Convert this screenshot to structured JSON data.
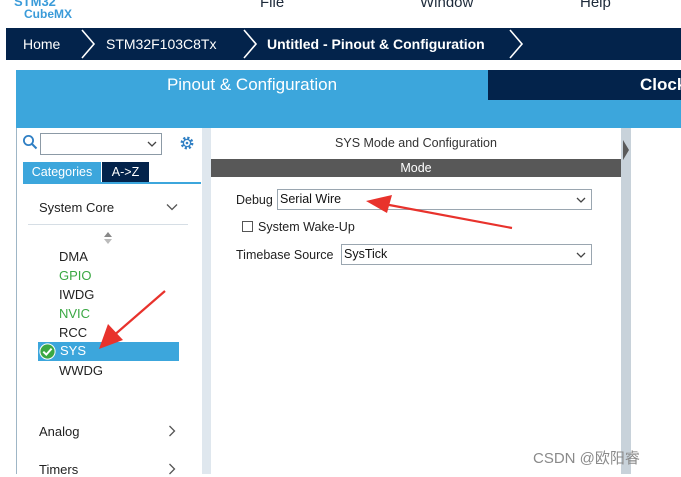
{
  "app": {
    "logo_line1": "STM32",
    "logo_line2": "CubeMX"
  },
  "menu": {
    "items": [
      "File",
      "Window",
      "Help"
    ]
  },
  "breadcrumb": {
    "items": [
      "Home",
      "STM32F103C8Tx",
      "Untitled - Pinout & Configuration"
    ]
  },
  "tabs": {
    "pinout": "Pinout & Configuration",
    "clock": "Clock"
  },
  "left": {
    "search_value": "",
    "category_tabs": [
      "Categories",
      "A->Z"
    ],
    "sections": [
      "System Core",
      "Analog",
      "Timers"
    ],
    "peripherals": [
      {
        "label": "DMA",
        "status": "normal"
      },
      {
        "label": "GPIO",
        "status": "green"
      },
      {
        "label": "IWDG",
        "status": "normal"
      },
      {
        "label": "NVIC",
        "status": "green"
      },
      {
        "label": "RCC",
        "status": "normal"
      },
      {
        "label": "SYS",
        "status": "selected"
      },
      {
        "label": "WWDG",
        "status": "normal"
      }
    ]
  },
  "right": {
    "panel_title": "SYS Mode and Configuration",
    "mode_header": "Mode",
    "debug_label": "Debug",
    "debug_value": "Serial Wire",
    "wakeup_label": "System Wake-Up",
    "wakeup_checked": false,
    "timebase_label": "Timebase Source",
    "timebase_value": "SysTick"
  },
  "watermark": "CSDN @欧阳睿",
  "colors": {
    "navy": "#03234b",
    "accent_blue": "#3ca6dc",
    "green": "#3aa843",
    "annotation_red": "#e8322c"
  }
}
